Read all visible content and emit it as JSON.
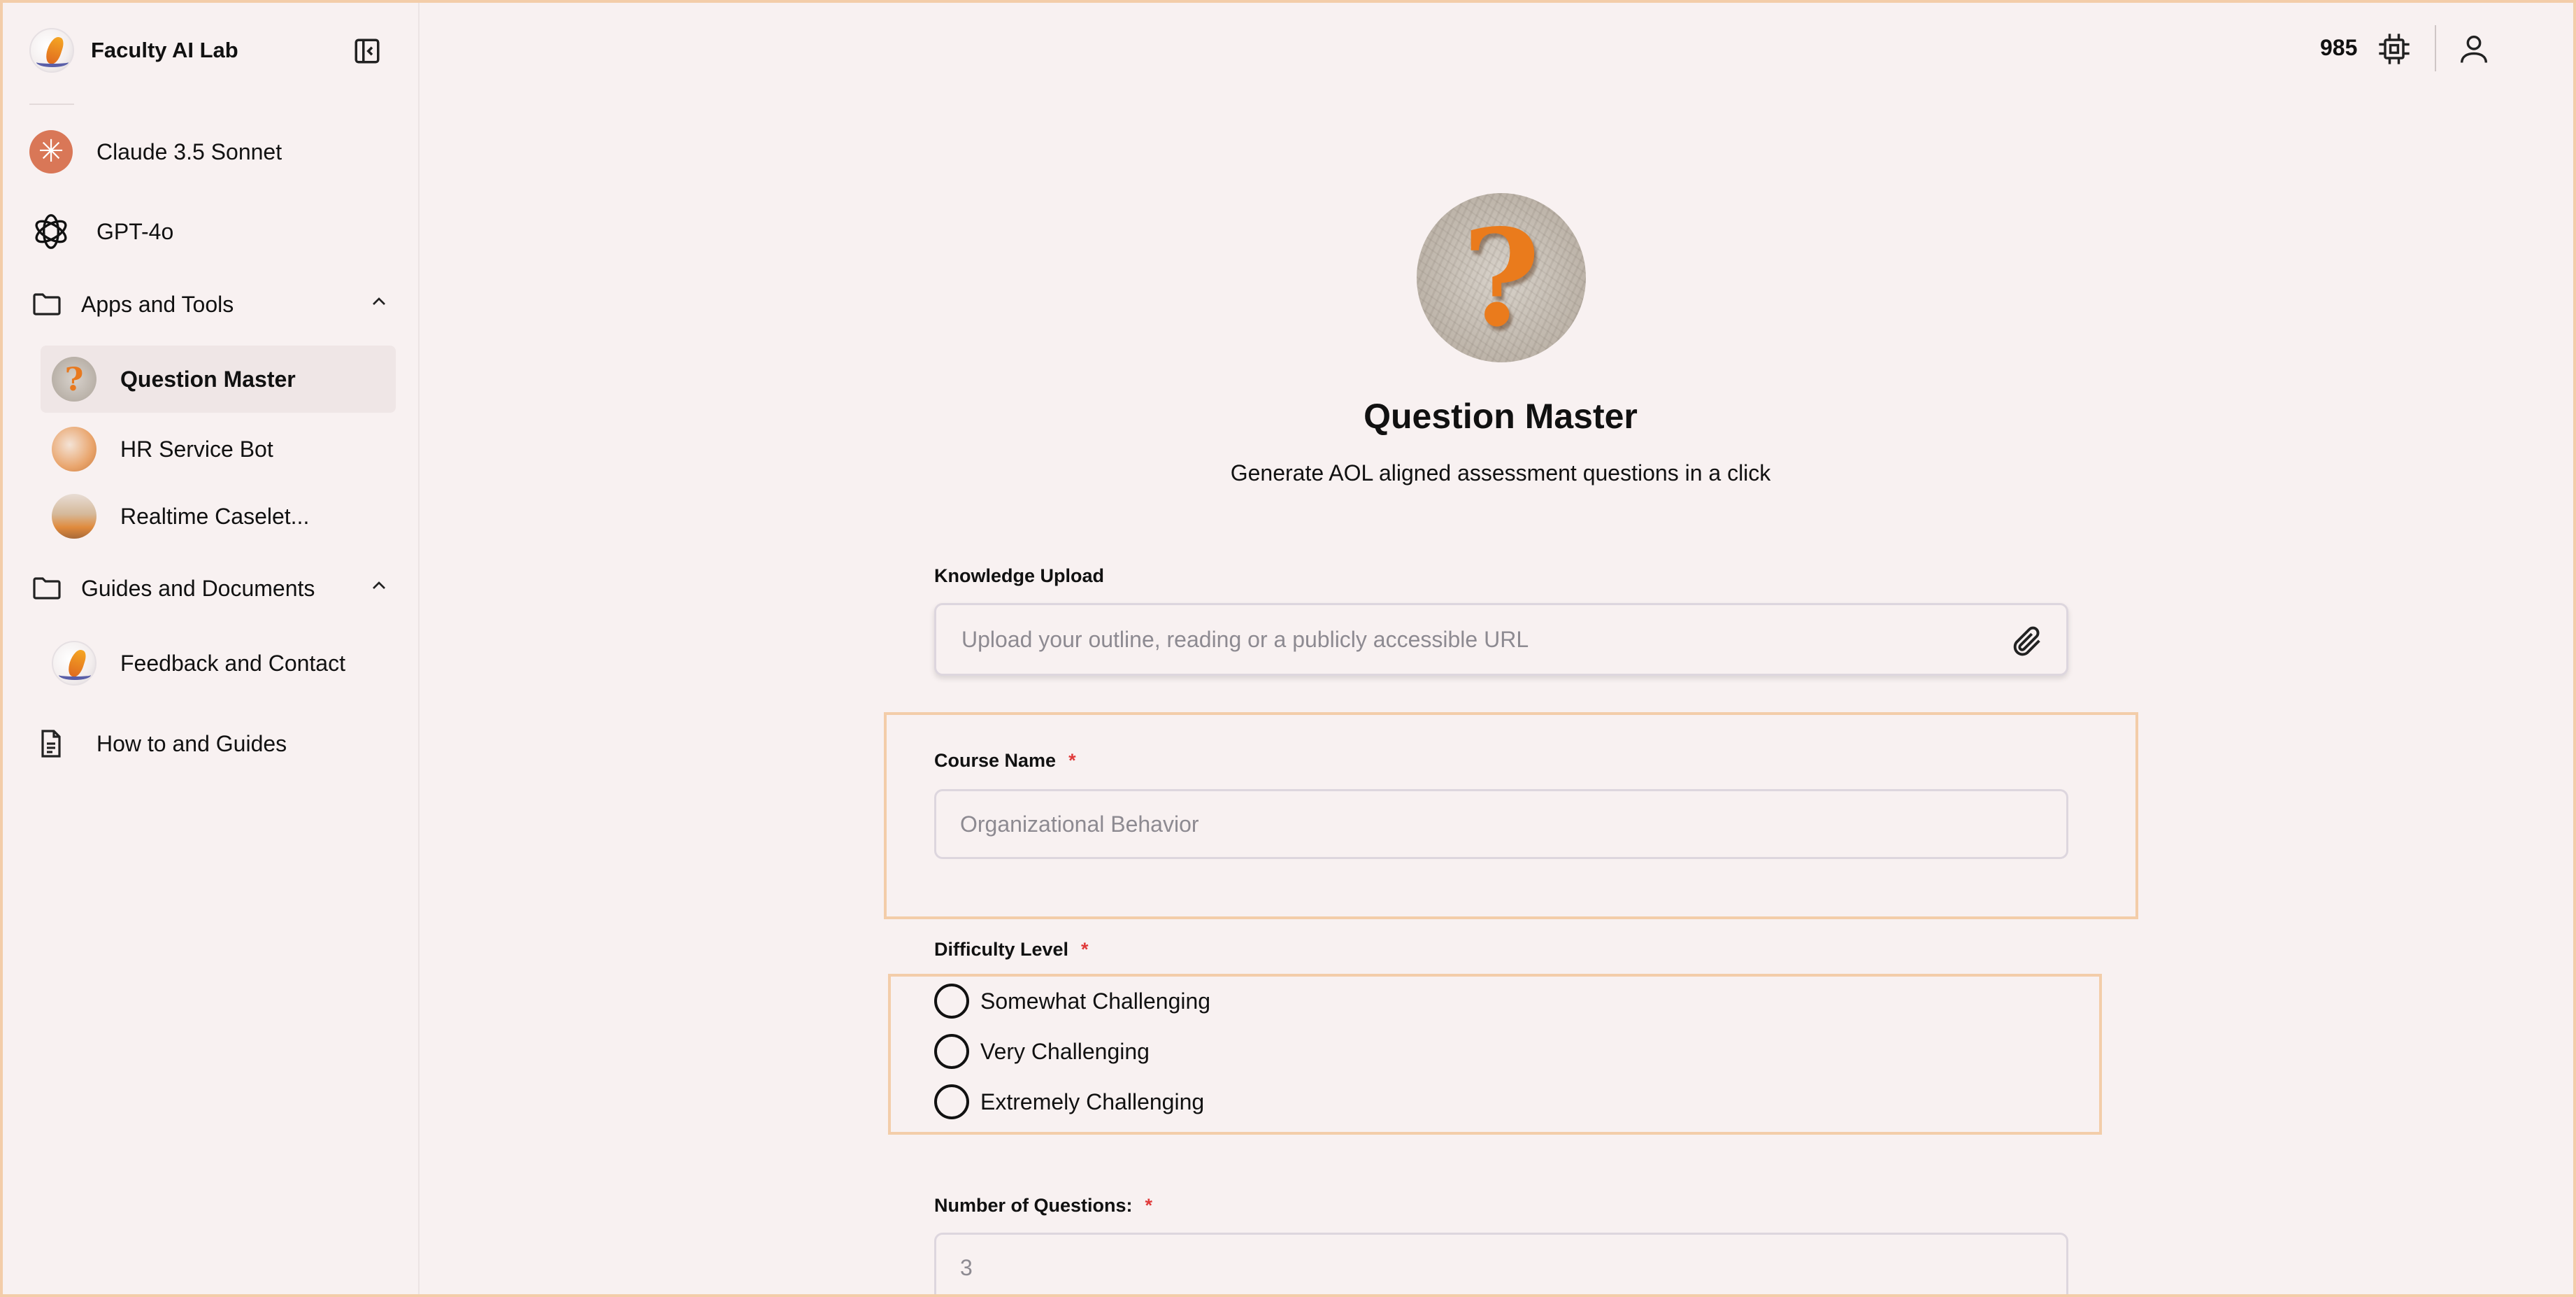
{
  "sidebar": {
    "brand": "Faculty AI Lab",
    "models": [
      {
        "label": "Claude 3.5 Sonnet",
        "icon": "claude-icon"
      },
      {
        "label": "GPT-4o",
        "icon": "openai-icon"
      }
    ],
    "apps_folder": {
      "label": "Apps and Tools",
      "items": [
        {
          "label": "Question Master"
        },
        {
          "label": "HR Service Bot"
        },
        {
          "label": "Realtime Caselet..."
        }
      ]
    },
    "guides_folder": {
      "label": "Guides and Documents",
      "items": [
        {
          "label": "Feedback and Contact"
        }
      ]
    },
    "how_to": "How to and Guides"
  },
  "topbar": {
    "credits": "985"
  },
  "main": {
    "title": "Question Master",
    "subtitle": "Generate AOL aligned assessment questions in a click",
    "knowledge_upload": {
      "label": "Knowledge Upload",
      "placeholder": "Upload your outline, reading or a publicly accessible URL"
    },
    "course_name": {
      "label": "Course Name",
      "required": "*",
      "placeholder": "Organizational Behavior"
    },
    "difficulty": {
      "label": "Difficulty Level",
      "required": "*",
      "options": [
        "Somewhat Challenging",
        "Very Challenging",
        "Extremely Challenging"
      ]
    },
    "num_questions": {
      "label": "Number of Questions:",
      "required": "*",
      "placeholder": "3"
    }
  },
  "colors": {
    "background": "#f8f1f1",
    "highlight_border": "#f3cda9",
    "claude_accent": "#d97757",
    "required_star": "#e03a3a",
    "question_mark": "#ea7b1c"
  }
}
